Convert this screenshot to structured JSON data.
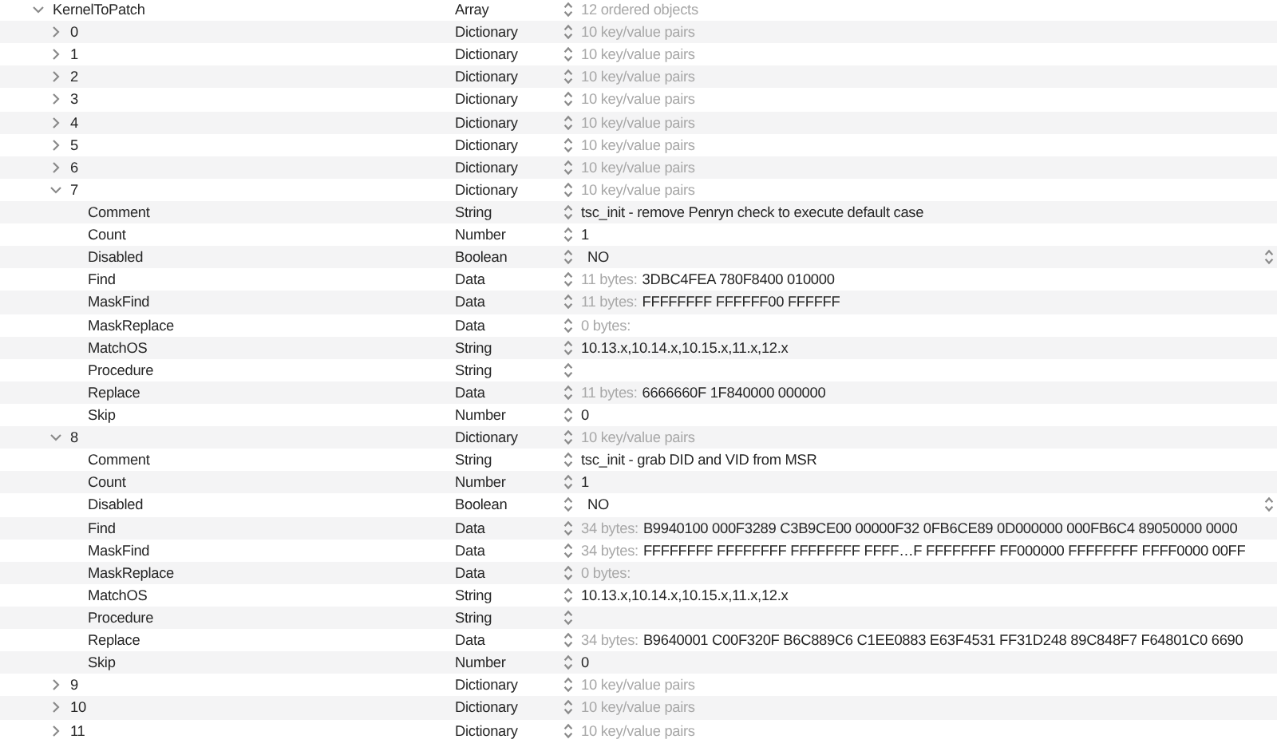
{
  "tree": [
    {
      "key": "KernelToPatch",
      "type": "Array",
      "expanded": true,
      "summary": "12 ordered objects",
      "children": [
        {
          "key": "0",
          "type": "Dictionary",
          "expanded": false,
          "summary": "10 key/value pairs"
        },
        {
          "key": "1",
          "type": "Dictionary",
          "expanded": false,
          "summary": "10 key/value pairs"
        },
        {
          "key": "2",
          "type": "Dictionary",
          "expanded": false,
          "summary": "10 key/value pairs"
        },
        {
          "key": "3",
          "type": "Dictionary",
          "expanded": false,
          "summary": "10 key/value pairs"
        },
        {
          "key": "4",
          "type": "Dictionary",
          "expanded": false,
          "summary": "10 key/value pairs"
        },
        {
          "key": "5",
          "type": "Dictionary",
          "expanded": false,
          "summary": "10 key/value pairs"
        },
        {
          "key": "6",
          "type": "Dictionary",
          "expanded": false,
          "summary": "10 key/value pairs"
        },
        {
          "key": "7",
          "type": "Dictionary",
          "expanded": true,
          "summary": "10 key/value pairs",
          "children": [
            {
              "key": "Comment",
              "type": "String",
              "value": "tsc_init - remove Penryn check to execute default case"
            },
            {
              "key": "Count",
              "type": "Number",
              "value": "1"
            },
            {
              "key": "Disabled",
              "type": "Boolean",
              "value": "NO"
            },
            {
              "key": "Find",
              "type": "Data",
              "summary": "11 bytes:",
              "value": "3DBC4FEA 780F8400 010000"
            },
            {
              "key": "MaskFind",
              "type": "Data",
              "summary": "11 bytes:",
              "value": "FFFFFFFF FFFFFF00 FFFFFF"
            },
            {
              "key": "MaskReplace",
              "type": "Data",
              "summary": "0 bytes:"
            },
            {
              "key": "MatchOS",
              "type": "String",
              "value": "10.13.x,10.14.x,10.15.x,11.x,12.x"
            },
            {
              "key": "Procedure",
              "type": "String"
            },
            {
              "key": "Replace",
              "type": "Data",
              "summary": "11 bytes:",
              "value": "6666660F 1F840000 000000"
            },
            {
              "key": "Skip",
              "type": "Number",
              "value": "0"
            }
          ]
        },
        {
          "key": "8",
          "type": "Dictionary",
          "expanded": true,
          "summary": "10 key/value pairs",
          "children": [
            {
              "key": "Comment",
              "type": "String",
              "value": "tsc_init - grab DID and VID from MSR"
            },
            {
              "key": "Count",
              "type": "Number",
              "value": "1"
            },
            {
              "key": "Disabled",
              "type": "Boolean",
              "value": "NO"
            },
            {
              "key": "Find",
              "type": "Data",
              "summary": "34 bytes:",
              "value": "B9940100 000F3289 C3B9CE00 00000F32 0FB6CE89 0D000000 000FB6C4 89050000 0000"
            },
            {
              "key": "MaskFind",
              "type": "Data",
              "summary": "34 bytes:",
              "value": "FFFFFFFF FFFFFFFF FFFFFFFF FFFF…F FFFFFFFF FF000000 FFFFFFFF FFFF0000 00FF"
            },
            {
              "key": "MaskReplace",
              "type": "Data",
              "summary": "0 bytes:"
            },
            {
              "key": "MatchOS",
              "type": "String",
              "value": "10.13.x,10.14.x,10.15.x,11.x,12.x"
            },
            {
              "key": "Procedure",
              "type": "String"
            },
            {
              "key": "Replace",
              "type": "Data",
              "summary": "34 bytes:",
              "value": "B9640001 C00F320F B6C889C6 C1EE0883 E63F4531 FF31D248 89C848F7 F64801C0 6690"
            },
            {
              "key": "Skip",
              "type": "Number",
              "value": "0"
            }
          ]
        },
        {
          "key": "9",
          "type": "Dictionary",
          "expanded": false,
          "summary": "10 key/value pairs"
        },
        {
          "key": "10",
          "type": "Dictionary",
          "expanded": false,
          "summary": "10 key/value pairs"
        },
        {
          "key": "11",
          "type": "Dictionary",
          "expanded": false,
          "summary": "10 key/value pairs"
        }
      ]
    }
  ]
}
